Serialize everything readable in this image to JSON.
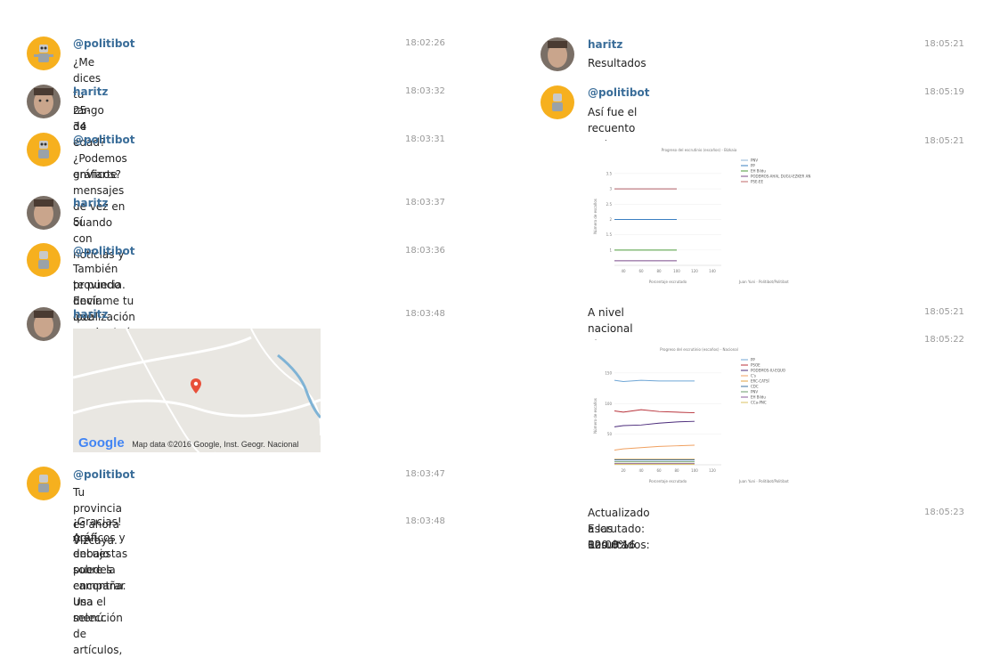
{
  "left": {
    "m1": {
      "name": "@politibot",
      "text": "¿Me dices tu rango de edad?",
      "time": "18:02:26"
    },
    "m2": {
      "name": "haritz",
      "text": "25-34",
      "time": "18:03:32"
    },
    "m3": {
      "name": "@politibot",
      "line1": "¿Podemos enviarte mensajes de vez en cuando con noticias y",
      "line2": "gráficos?",
      "time": "18:03:31"
    },
    "m4": {
      "name": "haritz",
      "text": "Sí",
      "time": "18:03:37"
    },
    "m5": {
      "name": "@politibot",
      "line1": "También te puedo decir qué resultado estima el CIS para tu",
      "line2": "provincia. Envíame tu localización y así sabré cuál es tu provincia.",
      "time": "18:03:36"
    },
    "m6": {
      "name": "haritz",
      "time": "18:03:48",
      "map_logo": "Google",
      "map_credit": "Map data ©2016 Google, Inst. Geogr. Nacional"
    },
    "m7": {
      "name": "@politibot",
      "text": "Tu provincia es ahora Vizcaya.",
      "time": "18:03:47"
    },
    "m8": {
      "line1": "¡Gracias! Aquí debajo puedes encontrar una selección de artículos,",
      "line2": "gráficos y encuestas sobre la campaña. Usa el menú.",
      "time": "18:03:48"
    }
  },
  "right": {
    "r1": {
      "name": "haritz",
      "text": "Resultados",
      "time": "18:05:21"
    },
    "r2": {
      "name": "@politibot",
      "text": "Así fue el recuento en tu provincia:",
      "time": "18:05:19"
    },
    "r3": {
      "time": "18:05:21",
      "chart_title": "Progreso del escrutinio (escaños) - Bizkaia",
      "ylabel": "Número de escaños",
      "xlabel": "Porcentaje escrutado",
      "credit": "Juan Yuni · Politibot/Politibot"
    },
    "r4": {
      "text": "A nivel nacional el recuento fue así:",
      "time": "18:05:21"
    },
    "r5": {
      "time": "18:05:22",
      "chart_title": "Progreso del escrutinio (escaños) - Nacional",
      "ylabel": "Número de escaños",
      "xlabel": "Porcentaje escrutado",
      "credit": "Juan Yuni · Politibot/Politibot"
    },
    "r6": {
      "line1": "Actualizado a las 02:08:16",
      "line2": "Escrutado: 100.0%",
      "line3": "Resultados:",
      "time": "18:05:23"
    }
  },
  "colors": {
    "name": "#3a6d99",
    "time": "#999999",
    "bot_avatar": "#f6b01e",
    "map_pin": "#e8503a"
  },
  "chart_data": [
    {
      "type": "line",
      "title": "Progreso del escrutinio (escaños) - Bizkaia",
      "xlabel": "Porcentaje escrutado",
      "ylabel": "Número de escaños",
      "xlim": [
        30,
        150
      ],
      "ylim": [
        0.5,
        3.7
      ],
      "x_ticks": [
        40,
        60,
        80,
        100,
        120,
        140
      ],
      "y_ticks": [
        1,
        1.5,
        2,
        2.5,
        3,
        3.5
      ],
      "series": [
        {
          "name": "PNV",
          "color": "#8fb3d6",
          "x": [
            30,
            100
          ],
          "y": [
            3,
            3
          ]
        },
        {
          "name": "PP",
          "color": "#3a7fc1",
          "x": [
            30,
            100
          ],
          "y": [
            2,
            2
          ]
        },
        {
          "name": "EH Bildu",
          "color": "#4b9a3a",
          "x": [
            30,
            100
          ],
          "y": [
            1,
            1
          ]
        },
        {
          "name": "PODEMOS-AHAL DUGU-EZKER ANITZA-IU-EQUO",
          "color": "#7a4a8a",
          "x": [
            30,
            100
          ],
          "y": [
            0.65,
            0.65
          ]
        },
        {
          "name": "PSE-EE",
          "color": "#c26a6a",
          "x": [
            30,
            100
          ],
          "y": [
            3,
            3
          ]
        }
      ]
    },
    {
      "type": "line",
      "title": "Progreso del escrutinio (escaños) - Nacional",
      "xlabel": "Porcentaje escrutado",
      "ylabel": "Número de escaños",
      "xlim": [
        10,
        130
      ],
      "ylim": [
        0,
        160
      ],
      "x_ticks": [
        20,
        40,
        60,
        80,
        100,
        120
      ],
      "y_ticks": [
        50,
        100,
        150
      ],
      "series": [
        {
          "name": "PP",
          "color": "#6fa6d6",
          "x": [
            10,
            20,
            40,
            60,
            80,
            100
          ],
          "y": [
            138,
            136,
            138,
            137,
            137,
            137
          ]
        },
        {
          "name": "PSOE",
          "color": "#b8323a",
          "x": [
            10,
            20,
            40,
            60,
            80,
            100
          ],
          "y": [
            88,
            86,
            90,
            87,
            86,
            85
          ]
        },
        {
          "name": "PODEMOS-IU-EQUO",
          "color": "#4a2a7a",
          "x": [
            10,
            20,
            40,
            60,
            80,
            100
          ],
          "y": [
            62,
            64,
            65,
            68,
            70,
            71
          ]
        },
        {
          "name": "C's",
          "color": "#f0a060",
          "x": [
            10,
            20,
            40,
            60,
            80,
            100
          ],
          "y": [
            24,
            26,
            28,
            30,
            31,
            32
          ]
        },
        {
          "name": "ERC-CATSÍ",
          "color": "#e0a040",
          "x": [
            10,
            100
          ],
          "y": [
            9,
            9
          ]
        },
        {
          "name": "CDC",
          "color": "#3a6fa0",
          "x": [
            10,
            100
          ],
          "y": [
            8,
            8
          ]
        },
        {
          "name": "PNV",
          "color": "#6a9a6a",
          "x": [
            10,
            100
          ],
          "y": [
            5,
            5
          ]
        },
        {
          "name": "EH Bildu",
          "color": "#8a5a9a",
          "x": [
            10,
            100
          ],
          "y": [
            2,
            2
          ]
        },
        {
          "name": "CCa-PNC",
          "color": "#d8c060",
          "x": [
            10,
            100
          ],
          "y": [
            1,
            1
          ]
        }
      ]
    }
  ]
}
